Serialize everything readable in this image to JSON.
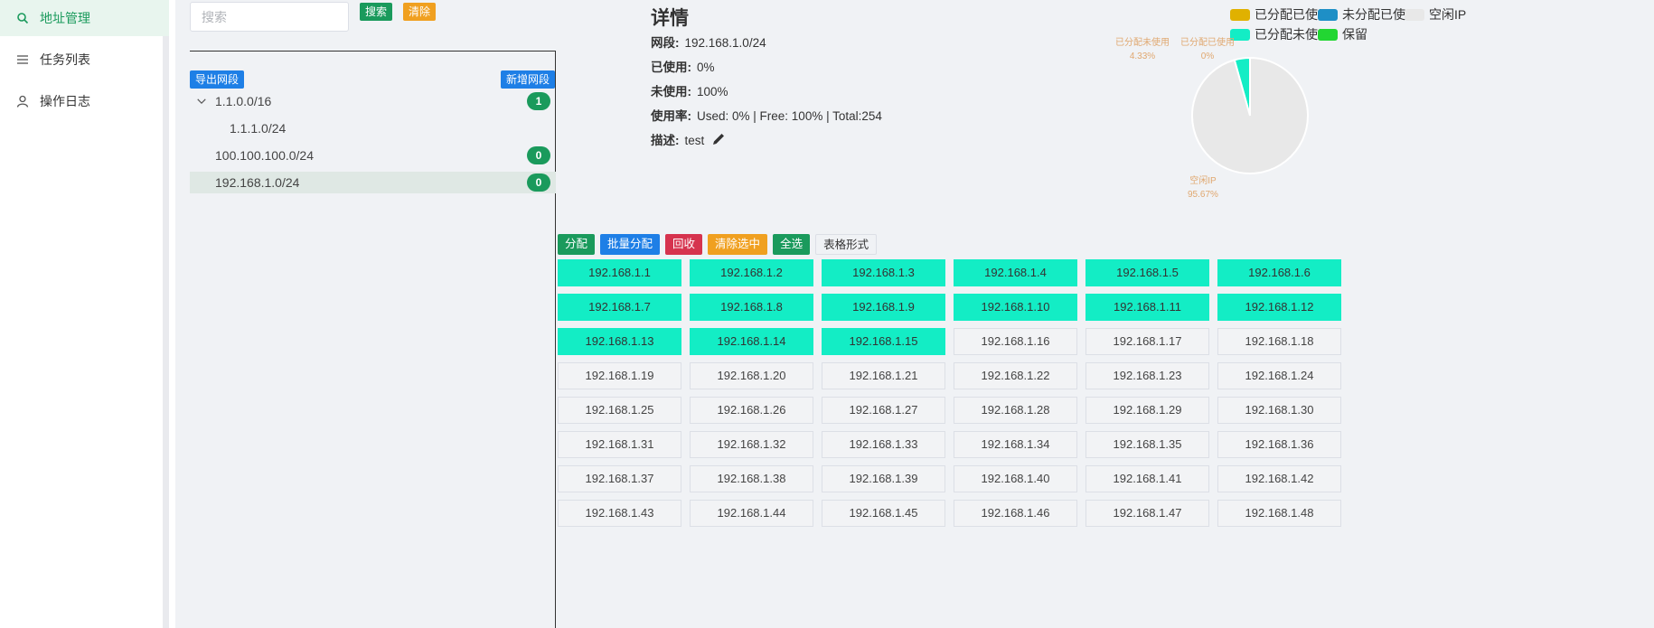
{
  "sidebar": {
    "items": [
      {
        "label": "地址管理",
        "icon": "search-icon",
        "active": true
      },
      {
        "label": "任务列表",
        "icon": "list-icon",
        "active": false
      },
      {
        "label": "操作日志",
        "icon": "user-icon",
        "active": false
      }
    ]
  },
  "tree": {
    "search_placeholder": "搜索",
    "search_label": "搜索",
    "clear_label": "清除",
    "export_label": "导出网段",
    "add_label": "新增网段",
    "nodes": [
      {
        "label": "1.1.0.0/16",
        "badge": "1",
        "expanded": true
      },
      {
        "label": "1.1.1.0/24",
        "badge": ""
      },
      {
        "label": "100.100.100.0/24",
        "badge": "0"
      },
      {
        "label": "192.168.1.0/24",
        "badge": "0",
        "selected": true
      }
    ]
  },
  "details": {
    "title": "详情",
    "segment_label": "网段:",
    "segment_value": "192.168.1.0/24",
    "used_label": "已使用:",
    "used_value": "0%",
    "unused_label": "未使用:",
    "unused_value": "100%",
    "rate_label": "使用率:",
    "rate_value": "Used: 0% | Free: 100% | Total:254",
    "desc_label": "描述:",
    "desc_value": "test"
  },
  "legend": {
    "items": [
      {
        "label": "已分配已使用",
        "color": "#e0b100"
      },
      {
        "label": "未分配已使用",
        "color": "#1e8fc6"
      },
      {
        "label": "空闲IP",
        "color": "#e8e8e8"
      },
      {
        "label": "已分配未使用",
        "color": "#13edc5"
      },
      {
        "label": "保留",
        "color": "#22d632"
      }
    ]
  },
  "chart_data": {
    "type": "pie",
    "slices": [
      {
        "name": "已分配未使用",
        "percent_label": "4.33%",
        "value": 4.33,
        "color": "#13edc5"
      },
      {
        "name": "已分配已使用",
        "percent_label": "0%",
        "value": 0,
        "color": "#e0b100"
      },
      {
        "name": "空闲IP",
        "percent_label": "95.67%",
        "value": 95.67,
        "color": "#e8e8e8"
      }
    ]
  },
  "actions": {
    "assign": "分配",
    "batch_assign": "批量分配",
    "reclaim": "回收",
    "clear_selected": "清除选中",
    "select_all": "全选",
    "table_mode": "表格形式"
  },
  "ip_list": {
    "used_count": 15,
    "start": 1,
    "end": 48,
    "prefix": "192.168.1."
  }
}
